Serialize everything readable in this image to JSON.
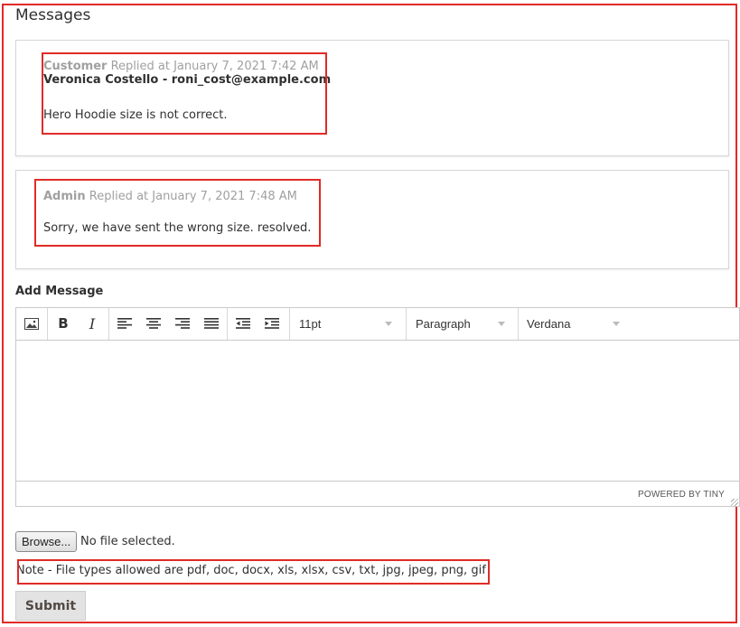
{
  "section": {
    "title": "Messages"
  },
  "messages": [
    {
      "role": "Customer",
      "meta": "Replied at January 7, 2021 7:42 AM",
      "sender": "Veronica Costello - roni_cost@example.com",
      "text": "Hero Hoodie size is not correct."
    },
    {
      "role": "Admin",
      "meta": "Replied at January 7, 2021 7:48 AM",
      "text": "Sorry, we have sent the wrong size. resolved."
    }
  ],
  "add_message": {
    "label": "Add Message",
    "toolbar": {
      "font_size": "11pt",
      "block_format": "Paragraph",
      "font_family": "Verdana"
    },
    "powered_by": "POWERED BY TINY"
  },
  "upload": {
    "browse_label": "Browse...",
    "status": "No file selected.",
    "note": "Note - File types allowed are pdf, doc, docx, xls, xlsx, csv, txt, jpg, jpeg, png, gif"
  },
  "submit_label": "Submit",
  "colors": {
    "highlight": "#e02b27",
    "meta": "#a0a0a0",
    "text": "#303030"
  }
}
